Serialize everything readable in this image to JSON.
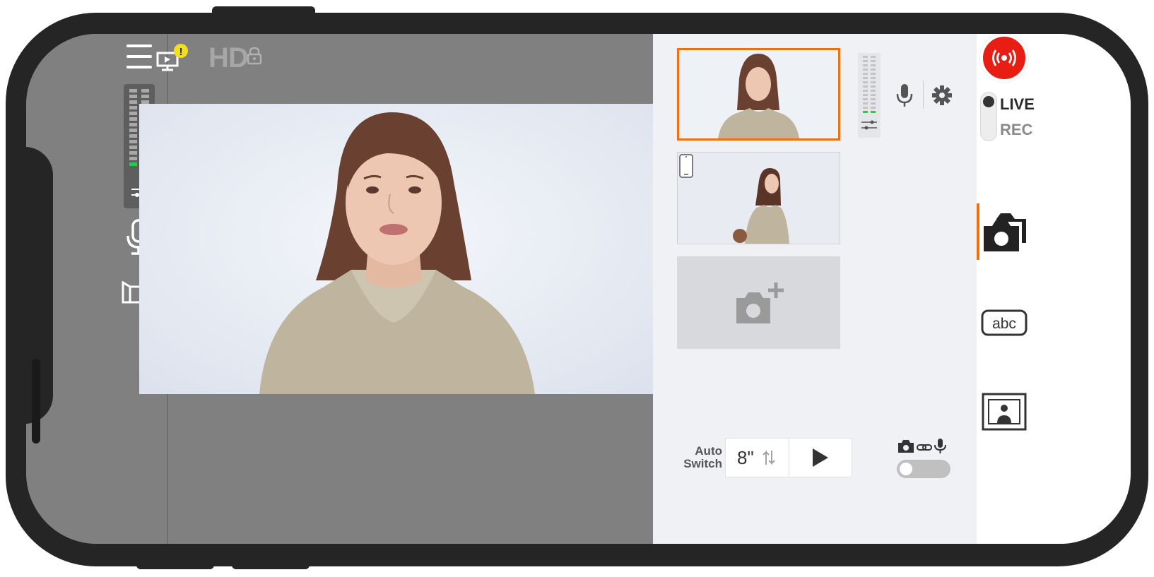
{
  "topbar": {
    "hd_label": "HD"
  },
  "thumbnails": [
    {
      "label": "camera-1",
      "selected": true
    },
    {
      "label": "camera-2",
      "selected": false
    },
    {
      "label": "add-camera",
      "selected": false
    }
  ],
  "auto_switch": {
    "label_line1": "Auto",
    "label_line2": "Switch",
    "interval": "8\""
  },
  "mode": {
    "live_label": "LIVE",
    "rec_label": "REC",
    "selected": "LIVE"
  },
  "sync_toggle": {
    "on": false
  },
  "colors": {
    "accent": "#f07010",
    "live": "#e81d14",
    "meter_green": "#20d040"
  },
  "icons": [
    "menu-icon",
    "audio-meter-sliders-icon",
    "mic-icon",
    "camera-flip-icon",
    "monitor-alert-icon",
    "lock-icon",
    "mic-icon",
    "gear-icon",
    "phone-icon",
    "add-camera-icon",
    "switch-order-icon",
    "play-icon",
    "camera-link-mic-icon",
    "live-broadcast-icon",
    "cameras-icon",
    "text-overlay-icon",
    "image-overlay-icon"
  ]
}
